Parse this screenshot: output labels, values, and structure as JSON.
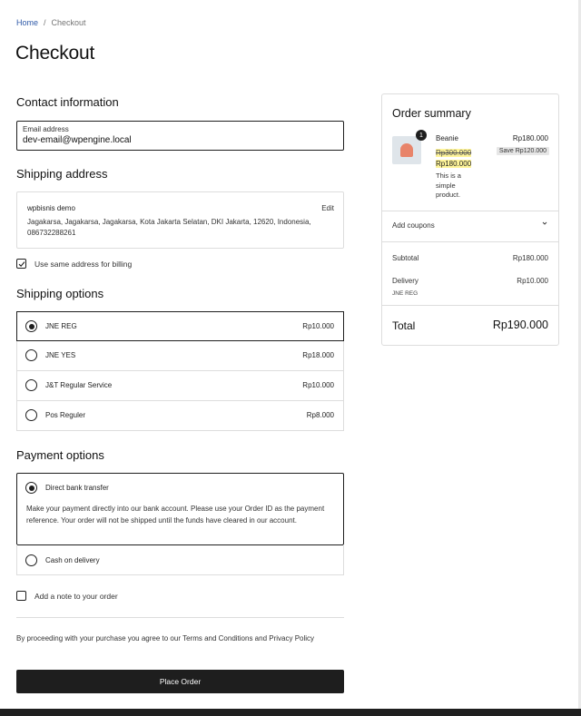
{
  "breadcrumb": {
    "home": "Home",
    "separator": "/",
    "current": "Checkout"
  },
  "page": {
    "title": "Checkout"
  },
  "contact": {
    "heading": "Contact information",
    "email_label": "Email address",
    "email_value": "dev-email@wpengine.local"
  },
  "shipping_address": {
    "heading": "Shipping address",
    "name": "wpbisnis demo",
    "edit_label": "Edit",
    "address": "Jagakarsa, Jagakarsa, Jagakarsa, Kota Jakarta Selatan, DKI Jakarta, 12620, Indonesia, 086732288261",
    "same_billing_label": "Use same address for billing",
    "same_billing_checked": true
  },
  "shipping_options": {
    "heading": "Shipping options",
    "options": [
      {
        "label": "JNE REG",
        "price": "Rp10.000",
        "selected": true
      },
      {
        "label": "JNE YES",
        "price": "Rp18.000",
        "selected": false
      },
      {
        "label": "J&T Regular Service",
        "price": "Rp10.000",
        "selected": false
      },
      {
        "label": "Pos Reguler",
        "price": "Rp8.000",
        "selected": false
      }
    ]
  },
  "payment": {
    "heading": "Payment options",
    "bank_label": "Direct bank transfer",
    "bank_description": "Make your payment directly into our bank account. Please use your Order ID as the payment reference. Your order will not be shipped until the funds have cleared in our account.",
    "cod_label": "Cash on delivery"
  },
  "note": {
    "label": "Add a note to your order"
  },
  "terms": {
    "text": "By proceeding with your purchase you agree to our Terms and Conditions and Privacy Policy"
  },
  "place_order": {
    "label": "Place Order"
  },
  "summary": {
    "heading": "Order summary",
    "item": {
      "quantity": "1",
      "name": "Beanie",
      "regular_price": "Rp300.000",
      "sale_price": "Rp180.000",
      "description": "This is a simple product.",
      "line_total": "Rp180.000",
      "save_badge": "Save Rp120.000"
    },
    "coupons_label": "Add coupons",
    "subtotal_label": "Subtotal",
    "subtotal_value": "Rp180.000",
    "delivery_label": "Delivery",
    "delivery_value": "Rp10.000",
    "delivery_method": "JNE REG",
    "total_label": "Total",
    "total_value": "Rp190.000"
  },
  "colors": {
    "accent": "#1e1e1e",
    "border": "#dddddd",
    "link": "#2f5aa8",
    "highlight": "#fff59a"
  },
  "icons": {
    "checkbox": "checkmark-icon",
    "chevron": "chevron-down-icon",
    "product": "beanie-thumbnail"
  }
}
